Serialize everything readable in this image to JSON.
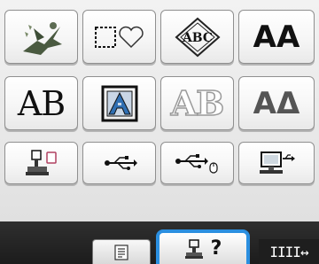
{
  "screen": {
    "row1": [
      {
        "name": "pattern-design-bird-icon",
        "kind": "icon"
      },
      {
        "name": "frame-shapes-icon",
        "kind": "icon"
      },
      {
        "name": "monogram-abc-icon",
        "kind": "icon"
      },
      {
        "name": "font-aa-button",
        "kind": "text",
        "text": "AA"
      }
    ],
    "row2": [
      {
        "name": "font-ab-button",
        "kind": "text",
        "text": "AB"
      },
      {
        "name": "framed-a-icon",
        "kind": "icon"
      },
      {
        "name": "outline-ab-button",
        "kind": "text",
        "text": "AB"
      },
      {
        "name": "greek-alpha-delta-button",
        "kind": "text",
        "text": "ΑΔ"
      }
    ],
    "row3": [
      {
        "name": "machine-memory-icon",
        "kind": "icon"
      },
      {
        "name": "usb-icon",
        "kind": "icon"
      },
      {
        "name": "usb-mouse-icon",
        "kind": "icon"
      },
      {
        "name": "computer-icon",
        "kind": "icon"
      }
    ]
  },
  "labels": {
    "font_aa": "AA",
    "font_ab": "AB",
    "outline_ab": "AB",
    "alpha_delta": "ΑΔ",
    "help_q": "?",
    "move": "IIII↔"
  },
  "colors": {
    "help_highlight": "#2b8fe0",
    "bottom_bar": "#1c1c1c",
    "outline_text": "#9a9a9a",
    "framed_a_blue": "#2f6fb3"
  }
}
